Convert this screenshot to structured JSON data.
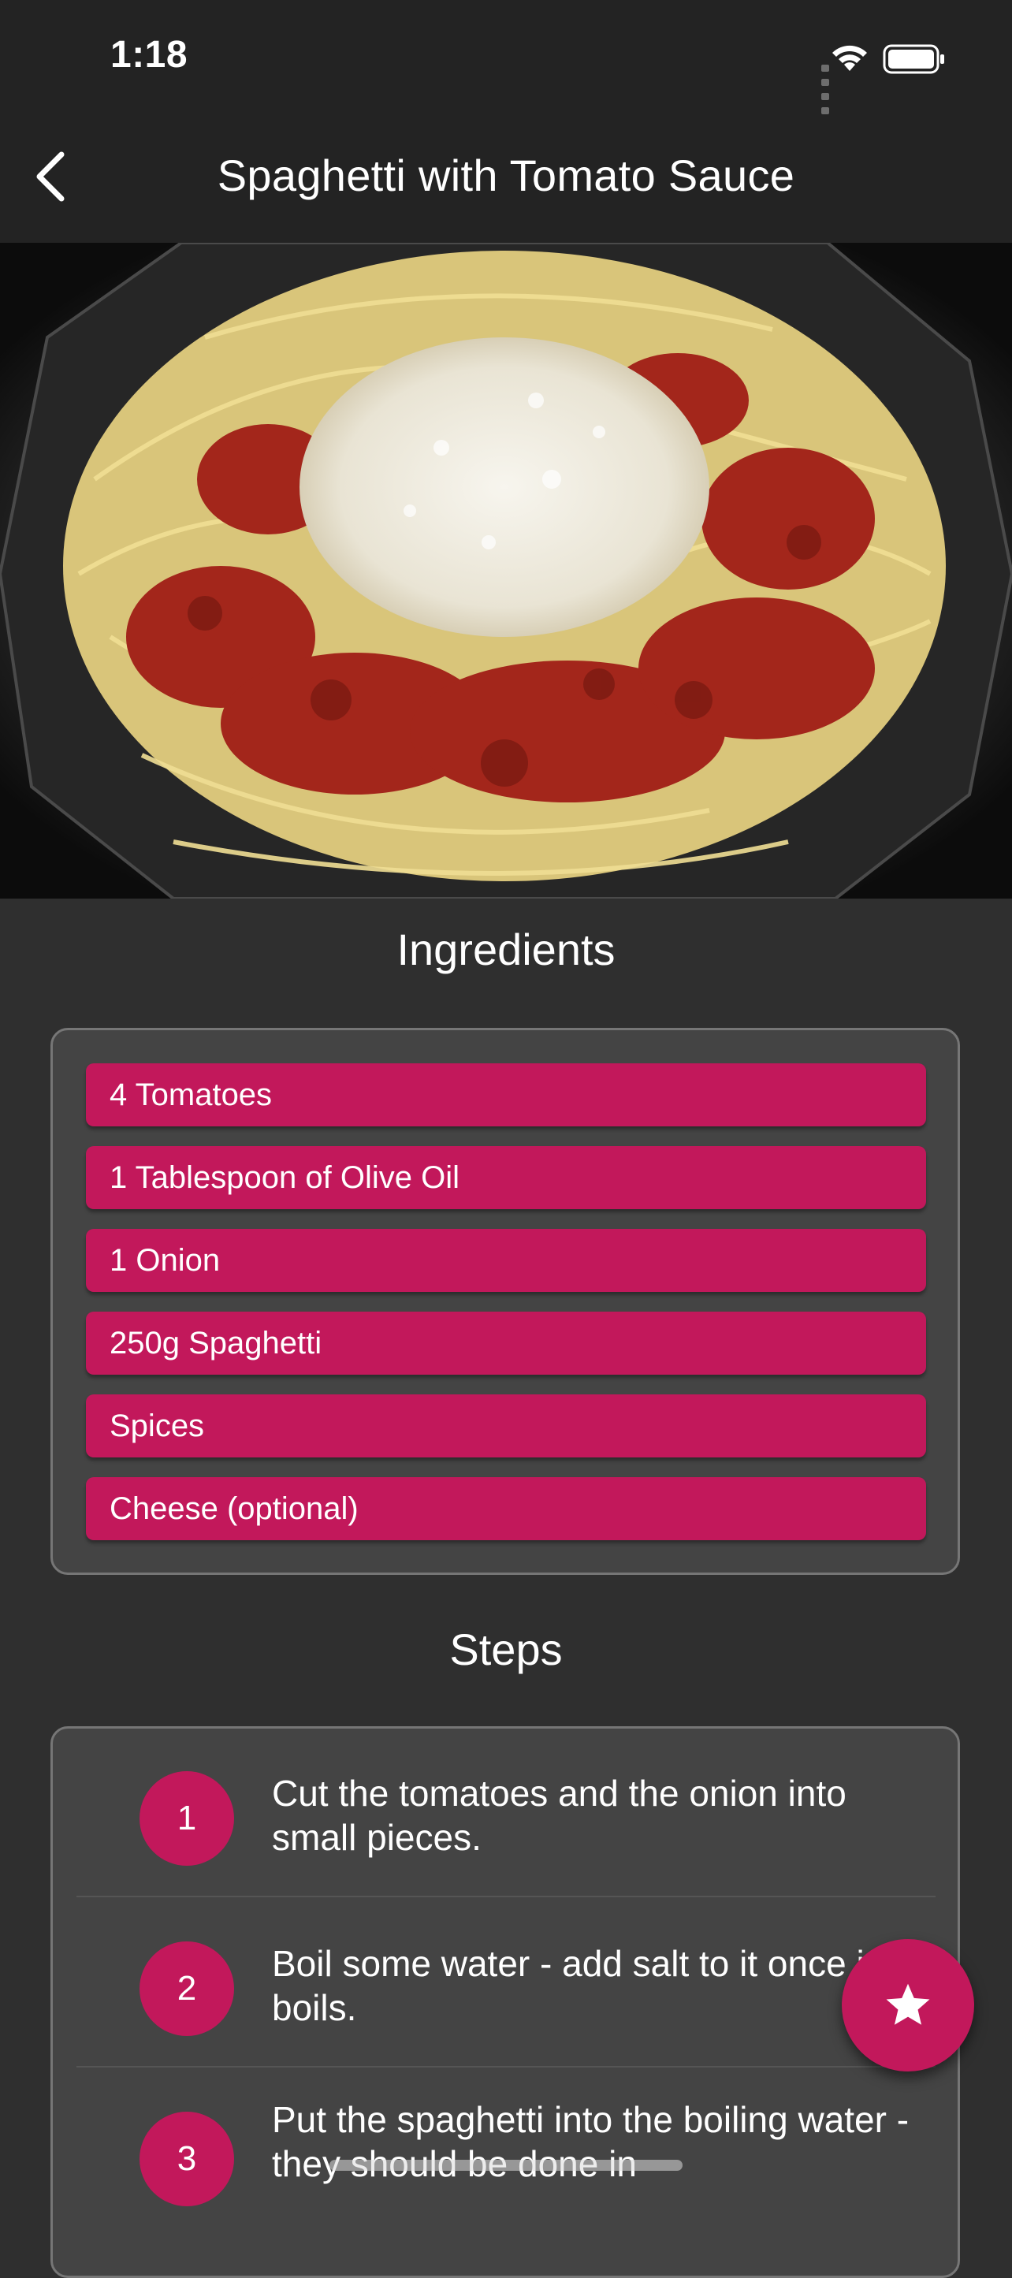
{
  "status_bar": {
    "time": "1:18"
  },
  "header": {
    "title": "Spaghetti with Tomato Sauce"
  },
  "ingredients": {
    "title": "Ingredients",
    "items": [
      "4 Tomatoes",
      "1 Tablespoon of Olive Oil",
      "1 Onion",
      "250g Spaghetti",
      "Spices",
      "Cheese (optional)"
    ]
  },
  "steps": {
    "title": "Steps",
    "items": [
      {
        "number": "1",
        "text": "Cut the tomatoes and the onion into small pieces."
      },
      {
        "number": "2",
        "text": "Boil some water - add salt to it once it boils."
      },
      {
        "number": "3",
        "text": "Put the spaghetti into the boiling water - they should be done in"
      }
    ]
  },
  "colors": {
    "accent": "#c2185b",
    "background": "#2f2f2f",
    "bar": "#232323",
    "card": "#444444"
  },
  "icons": {
    "back": "chevron-left-icon",
    "favorite": "star-icon"
  }
}
